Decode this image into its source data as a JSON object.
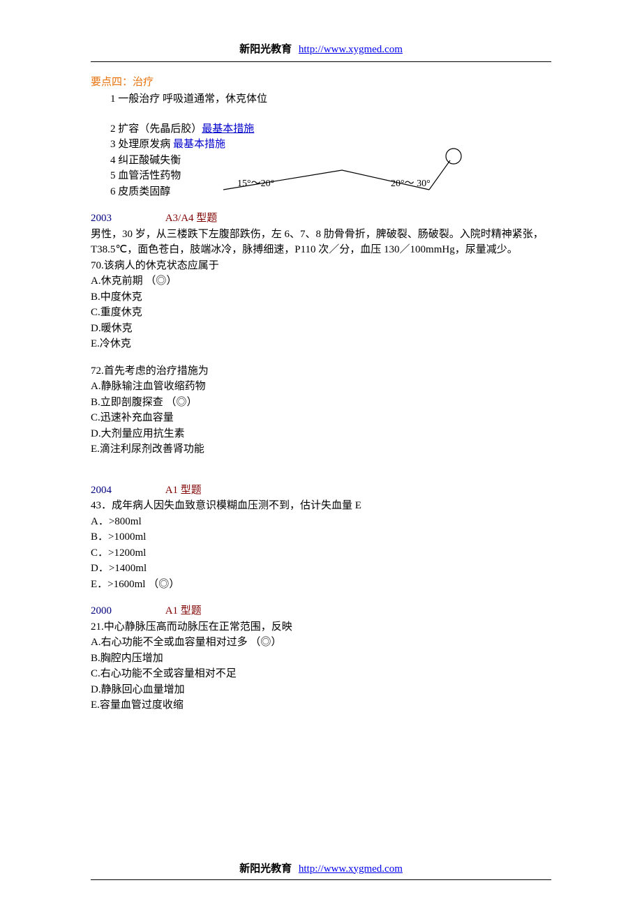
{
  "header": {
    "brand": "新阳光教育",
    "link_text": "http://www.xygmed.com"
  },
  "footer": {
    "brand": "新阳光教育",
    "link_text": "http://www.xygmed.com"
  },
  "diagram": {
    "left_label": "15°～20°",
    "right_label": "20°～ 30°"
  },
  "section4": {
    "title": "要点四：治疗",
    "items": {
      "i1": "1  一般治疗    呼吸道通常，休克体位",
      "i2_prefix": "2  扩容（先晶后胶）",
      "i2_blue": "最基本措施",
      "i3_prefix": "3  处理原发病  ",
      "i3_blue": "最基本措施",
      "i4": "4  纠正酸碱失衡",
      "i5": "5  血管活性药物",
      "i6": "6  皮质类固醇"
    }
  },
  "q2003": {
    "year": "2003",
    "type": "A3/A4 型题",
    "stem": "男性，30 岁，从三楼跌下左腹部跌伤，左 6、7、8 肋骨骨折，脾破裂、肠破裂。入院时精神紧张，T38.5℃，面色苍白，肢端冰冷，脉搏细速，P110 次／分，血压 130／100mmHg，尿量减少。",
    "q70": {
      "text": "70.该病人的休克状态应属于",
      "A": "A.休克前期  （◎）",
      "B": "B.中度休克",
      "C": "C.重度休克",
      "D": "D.暖休克",
      "E": "E.冷休克"
    },
    "q72": {
      "text": "72.首先考虑的治疗措施为",
      "A": "A.静脉输注血管收缩药物",
      "B": "B.立即剖腹探查  （◎）",
      "C": "C.迅速补充血容量",
      "D": "D.大剂量应用抗生素",
      "E": "E.滴注利尿剂改善肾功能"
    }
  },
  "q2004": {
    "year": "2004",
    "type": "A1 型题",
    "q43": {
      "text": "43．成年病人因失血致意识模糊血压测不到，估计失血量 E",
      "A": "A．>800ml",
      "B": "B．>1000ml",
      "C": "C．>1200ml",
      "D": "D．>1400ml",
      "E": "E．>1600ml    （◎）"
    }
  },
  "q2000": {
    "year": "2000",
    "type": "A1 型题",
    "q21": {
      "text": "21.中心静脉压高而动脉压在正常范围，反映",
      "A": "A.右心功能不全或血容量相对过多  （◎）",
      "B": "B.胸腔内压增加",
      "C": "C.右心功能不全或容量相对不足",
      "D": "D.静脉回心血量增加",
      "E": "E.容量血管过度收缩"
    }
  }
}
